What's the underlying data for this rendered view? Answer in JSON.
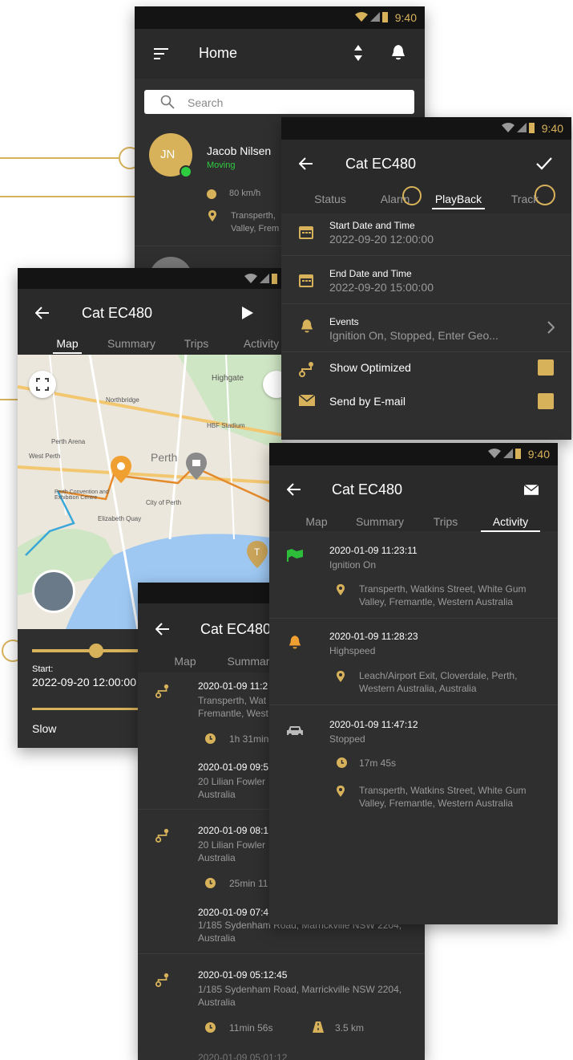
{
  "home": {
    "time": "9:40",
    "title": "Home",
    "search_placeholder": "Search",
    "avatar_initials": "JN",
    "contact_name": "Jacob Nilsen",
    "contact_status": "Moving",
    "speed": "80 km/h",
    "address_line1": "Transperth,",
    "address_line2": "Valley, Frem"
  },
  "settings": {
    "time": "9:40",
    "title": "Cat EC480",
    "tabs": [
      "Status",
      "Alarm",
      "PlayBack",
      "Track"
    ],
    "start_label": "Start Date and Time",
    "start_value": "2022-09-20 12:00:00",
    "end_label": "End Date and Time",
    "end_value": "2022-09-20 15:00:00",
    "events_label": "Events",
    "events_value": "Ignition On, Stopped, Enter Geo...",
    "show_optimized": "Show Optimized",
    "send_email": "Send by E-mail"
  },
  "map": {
    "title": "Cat EC480",
    "tabs": [
      "Map",
      "Summary",
      "Trips",
      "Activity"
    ],
    "labels": [
      "Highgate",
      "Perth",
      "City of Perth",
      "Elizabeth Quay",
      "Perth Arena",
      "Perth Convention and Exhibition Centre",
      "Northbridge",
      "West Perth",
      "HBF Stadium"
    ],
    "start_label": "Start:",
    "start_value": "2022-09-20 12:00:00",
    "speed_label": "Slow"
  },
  "trips": {
    "title": "Cat EC480",
    "tabs": [
      "Map",
      "Summar"
    ],
    "items": [
      {
        "date": "2020-01-09 11:2",
        "line1": "Transperth, Wat",
        "line2": "Fremantle, West"
      },
      {
        "duration": "1h 31min"
      },
      {
        "date": "2020-01-09 09:5",
        "line1": "20 Lilian Fowler",
        "line2": "Australia"
      },
      {
        "date": "2020-01-09 08:1",
        "line1": "20 Lilian Fowler",
        "line2": "Australia"
      },
      {
        "duration": "25min 11"
      },
      {
        "date": "2020-01-09 07:4",
        "line1": "1/185 Sydenham Road, Marrickville NSW 2204,",
        "line2": "Australia"
      },
      {
        "date": "2020-01-09 05:12:45",
        "line1": "1/185 Sydenham Road, Marrickville NSW 2204,",
        "line2": "Australia"
      },
      {
        "duration": "11min 56s",
        "distance": "3.5 km"
      },
      {
        "date": "2020-01-09 05:01:12"
      }
    ]
  },
  "activity": {
    "time": "9:40",
    "title": "Cat EC480",
    "tabs": [
      "Map",
      "Summary",
      "Trips",
      "Activity"
    ],
    "events": [
      {
        "date": "2020-01-09 11:23:11",
        "type": "Ignition On",
        "addr1": "Transperth, Watkins Street, White Gum",
        "addr2": "Valley, Fremantle, Western Australia"
      },
      {
        "date": "2020-01-09 11:28:23",
        "type": "Highspeed",
        "addr1": "Leach/Airport Exit, Cloverdale, Perth,",
        "addr2": "Western Australia, Australia"
      },
      {
        "date": "2020-01-09 11:47:12",
        "type": "Stopped",
        "duration": "17m 45s",
        "addr1": "Transperth, Watkins Street, White Gum",
        "addr2": "Valley, Fremantle, Western Australia"
      }
    ]
  },
  "colors": {
    "accent": "#d7b25a",
    "bg": "#2f2f2f",
    "status_green": "#2ecc40",
    "event_green": "#2ebd3a",
    "event_orange": "#f0a030"
  },
  "icons": [
    "menu-icon",
    "sort-icon",
    "bell-icon",
    "search-icon",
    "back-icon",
    "check-icon",
    "calendar-icon",
    "route-icon",
    "mail-icon",
    "chevron-right-icon",
    "play-icon",
    "fullscreen-icon",
    "layers-icon",
    "clock-icon",
    "location-pin-icon",
    "car-icon",
    "road-icon",
    "flag-icon"
  ]
}
